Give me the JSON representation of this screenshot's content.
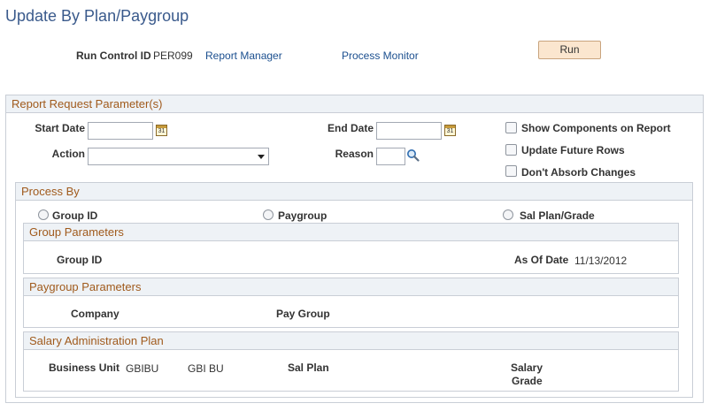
{
  "page": {
    "title": "Update By Plan/Paygroup"
  },
  "header": {
    "run_control_label": "Run Control ID",
    "run_control_value": "PER099",
    "report_manager_link": "Report Manager",
    "process_monitor_link": "Process Monitor",
    "run_button": "Run"
  },
  "report_params": {
    "title": "Report Request Parameter(s)",
    "start_date_label": "Start Date",
    "end_date_label": "End Date",
    "action_label": "Action",
    "reason_label": "Reason",
    "checkboxes": [
      {
        "label": "Show Components on Report",
        "checked": false
      },
      {
        "label": "Update Future Rows",
        "checked": false
      },
      {
        "label": "Don't Absorb Changes",
        "checked": false
      }
    ]
  },
  "process_by": {
    "title": "Process By",
    "options": [
      "Group ID",
      "Paygroup",
      "Sal Plan/Grade"
    ]
  },
  "group_params": {
    "title": "Group Parameters",
    "group_id_label": "Group ID",
    "as_of_date_label": "As Of Date",
    "as_of_date_value": "11/13/2012"
  },
  "paygroup_params": {
    "title": "Paygroup Parameters",
    "company_label": "Company",
    "pay_group_label": "Pay Group"
  },
  "salary_plan": {
    "title": "Salary Administration Plan",
    "business_unit_label": "Business Unit",
    "business_unit_value": "GBIBU",
    "business_unit_desc": "GBI BU",
    "sal_plan_label": "Sal Plan",
    "salary_grade_label_1": "Salary",
    "salary_grade_label_2": "Grade"
  },
  "colors": {
    "title": "#3a5a8c",
    "section_header": "#a05a1c",
    "link": "#1b4f8f",
    "button_bg": "#fbe6cf"
  }
}
